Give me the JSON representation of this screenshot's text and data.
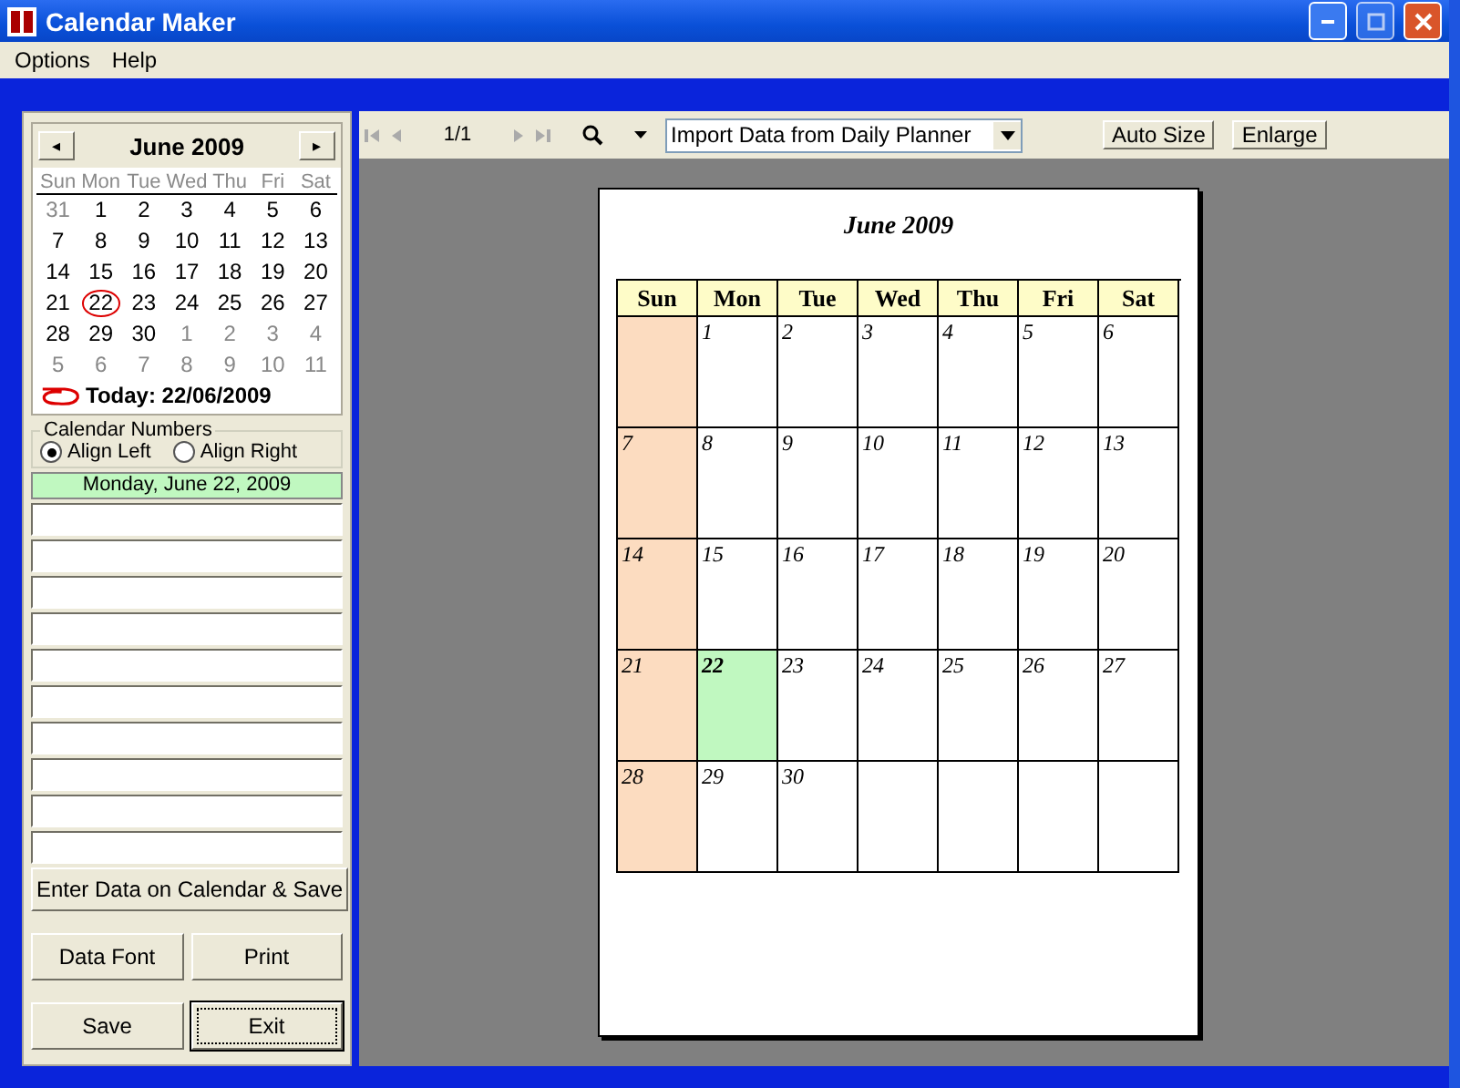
{
  "window": {
    "title": "Calendar Maker"
  },
  "menu": [
    "Options",
    "Help"
  ],
  "mini_calendar": {
    "prev": "◂",
    "next": "▸",
    "title": "June 2009",
    "weekdays": [
      "Sun",
      "Mon",
      "Tue",
      "Wed",
      "Thu",
      "Fri",
      "Sat"
    ],
    "weeks": [
      [
        {
          "day": "31",
          "in_month": false,
          "today": false
        },
        {
          "day": "1",
          "in_month": true,
          "today": false
        },
        {
          "day": "2",
          "in_month": true,
          "today": false
        },
        {
          "day": "3",
          "in_month": true,
          "today": false
        },
        {
          "day": "4",
          "in_month": true,
          "today": false
        },
        {
          "day": "5",
          "in_month": true,
          "today": false
        },
        {
          "day": "6",
          "in_month": true,
          "today": false
        }
      ],
      [
        {
          "day": "7",
          "in_month": true,
          "today": false
        },
        {
          "day": "8",
          "in_month": true,
          "today": false
        },
        {
          "day": "9",
          "in_month": true,
          "today": false
        },
        {
          "day": "10",
          "in_month": true,
          "today": false
        },
        {
          "day": "11",
          "in_month": true,
          "today": false
        },
        {
          "day": "12",
          "in_month": true,
          "today": false
        },
        {
          "day": "13",
          "in_month": true,
          "today": false
        }
      ],
      [
        {
          "day": "14",
          "in_month": true,
          "today": false
        },
        {
          "day": "15",
          "in_month": true,
          "today": false
        },
        {
          "day": "16",
          "in_month": true,
          "today": false
        },
        {
          "day": "17",
          "in_month": true,
          "today": false
        },
        {
          "day": "18",
          "in_month": true,
          "today": false
        },
        {
          "day": "19",
          "in_month": true,
          "today": false
        },
        {
          "day": "20",
          "in_month": true,
          "today": false
        }
      ],
      [
        {
          "day": "21",
          "in_month": true,
          "today": false
        },
        {
          "day": "22",
          "in_month": true,
          "today": true
        },
        {
          "day": "23",
          "in_month": true,
          "today": false
        },
        {
          "day": "24",
          "in_month": true,
          "today": false
        },
        {
          "day": "25",
          "in_month": true,
          "today": false
        },
        {
          "day": "26",
          "in_month": true,
          "today": false
        },
        {
          "day": "27",
          "in_month": true,
          "today": false
        }
      ],
      [
        {
          "day": "28",
          "in_month": true,
          "today": false
        },
        {
          "day": "29",
          "in_month": true,
          "today": false
        },
        {
          "day": "30",
          "in_month": true,
          "today": false
        },
        {
          "day": "1",
          "in_month": false,
          "today": false
        },
        {
          "day": "2",
          "in_month": false,
          "today": false
        },
        {
          "day": "3",
          "in_month": false,
          "today": false
        },
        {
          "day": "4",
          "in_month": false,
          "today": false
        }
      ],
      [
        {
          "day": "5",
          "in_month": false,
          "today": false
        },
        {
          "day": "6",
          "in_month": false,
          "today": false
        },
        {
          "day": "7",
          "in_month": false,
          "today": false
        },
        {
          "day": "8",
          "in_month": false,
          "today": false
        },
        {
          "day": "9",
          "in_month": false,
          "today": false
        },
        {
          "day": "10",
          "in_month": false,
          "today": false
        },
        {
          "day": "11",
          "in_month": false,
          "today": false
        }
      ]
    ],
    "today_label": "Today: 22/06/2009"
  },
  "calendar_numbers": {
    "title": "Calendar Numbers",
    "options": [
      {
        "label": "Align Left",
        "selected": true
      },
      {
        "label": "Align Right",
        "selected": false
      }
    ]
  },
  "selected_date": "Monday, June 22, 2009",
  "buttons": {
    "enter": "Enter Data on Calendar & Save",
    "data_font": "Data Font",
    "print": "Print",
    "save": "Save",
    "exit": "Exit"
  },
  "toolbar": {
    "page": "1/1",
    "import_select": "Import Data from Daily Planner",
    "auto_size": "Auto Size",
    "enlarge": "Enlarge"
  },
  "preview": {
    "title": "June 2009",
    "weekdays": [
      "Sun",
      "Mon",
      "Tue",
      "Wed",
      "Thu",
      "Fri",
      "Sat"
    ],
    "weeks": [
      [
        {
          "kind": "blank"
        },
        {
          "kind": "day",
          "day": "1",
          "selected": false
        },
        {
          "kind": "day",
          "day": "2",
          "selected": false
        },
        {
          "kind": "day",
          "day": "3",
          "selected": false
        },
        {
          "kind": "day",
          "day": "4",
          "selected": false
        },
        {
          "kind": "day",
          "day": "5",
          "selected": false
        },
        {
          "kind": "day",
          "day": "6",
          "selected": false
        }
      ],
      [
        {
          "kind": "day",
          "day": "7",
          "selected": false
        },
        {
          "kind": "day",
          "day": "8",
          "selected": false
        },
        {
          "kind": "day",
          "day": "9",
          "selected": false
        },
        {
          "kind": "day",
          "day": "10",
          "selected": false
        },
        {
          "kind": "day",
          "day": "11",
          "selected": false
        },
        {
          "kind": "day",
          "day": "12",
          "selected": false
        },
        {
          "kind": "day",
          "day": "13",
          "selected": false
        }
      ],
      [
        {
          "kind": "day",
          "day": "14",
          "selected": false
        },
        {
          "kind": "day",
          "day": "15",
          "selected": false
        },
        {
          "kind": "day",
          "day": "16",
          "selected": false
        },
        {
          "kind": "day",
          "day": "17",
          "selected": false
        },
        {
          "kind": "day",
          "day": "18",
          "selected": false
        },
        {
          "kind": "day",
          "day": "19",
          "selected": false
        },
        {
          "kind": "day",
          "day": "20",
          "selected": false
        }
      ],
      [
        {
          "kind": "day",
          "day": "21",
          "selected": false
        },
        {
          "kind": "day",
          "day": "22",
          "selected": true
        },
        {
          "kind": "day",
          "day": "23",
          "selected": false
        },
        {
          "kind": "day",
          "day": "24",
          "selected": false
        },
        {
          "kind": "day",
          "day": "25",
          "selected": false
        },
        {
          "kind": "day",
          "day": "26",
          "selected": false
        },
        {
          "kind": "day",
          "day": "27",
          "selected": false
        }
      ],
      [
        {
          "kind": "day",
          "day": "28",
          "selected": false
        },
        {
          "kind": "day",
          "day": "29",
          "selected": false
        },
        {
          "kind": "day",
          "day": "30",
          "selected": false
        },
        {
          "kind": "blank"
        },
        {
          "kind": "blank"
        },
        {
          "kind": "blank"
        },
        {
          "kind": "blank"
        }
      ]
    ]
  }
}
